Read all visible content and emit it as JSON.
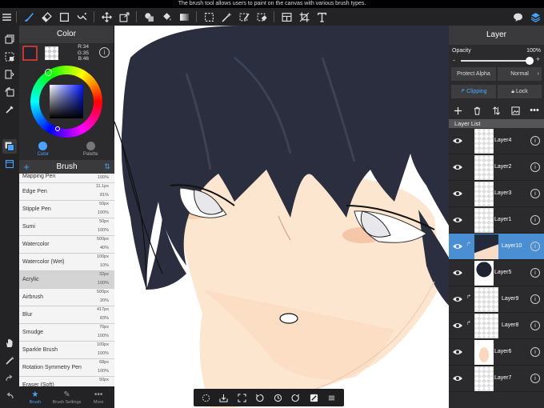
{
  "tip": "The brush tool allows users to paint on the canvas with various brush types.",
  "toolbar": {
    "icons": [
      "brush-icon",
      "eraser-icon",
      "rectangle-icon",
      "magic-brush-icon",
      "move-icon",
      "transform-icon",
      "fill-icon",
      "bucket-icon",
      "gradient-icon",
      "lasso-select-icon",
      "magic-wand-icon",
      "select-pen-icon",
      "select-eraser-icon",
      "layout-icon",
      "crop-icon",
      "text-icon",
      "chat-icon",
      "layers-icon"
    ]
  },
  "color": {
    "title": "Color",
    "r": "R:34",
    "g": "G:35",
    "b": "B:46",
    "main_hex": "#22232e",
    "tabs": [
      {
        "label": "Color"
      },
      {
        "label": "Palette"
      }
    ]
  },
  "brush": {
    "title": "Brush",
    "items": [
      {
        "name": "Mapping Pen",
        "size": "",
        "opacity": "100%"
      },
      {
        "name": "Edge Pen",
        "size": "11.1px",
        "opacity": "81%"
      },
      {
        "name": "Stipple Pen",
        "size": "50px",
        "opacity": "100%"
      },
      {
        "name": "Sumi",
        "size": "50px",
        "opacity": "100%"
      },
      {
        "name": "Watercolor",
        "size": "500px",
        "opacity": "40%"
      },
      {
        "name": "Watercolor (Wet)",
        "size": "100px",
        "opacity": "10%"
      },
      {
        "name": "Acrylic",
        "size": "32px",
        "opacity": "100%"
      },
      {
        "name": "Airbrush",
        "size": "500px",
        "opacity": "20%"
      },
      {
        "name": "Blur",
        "size": "417px",
        "opacity": "83%"
      },
      {
        "name": "Smudge",
        "size": "70px",
        "opacity": "100%"
      },
      {
        "name": "Sparkle Brush",
        "size": "100px",
        "opacity": "100%"
      },
      {
        "name": "Rotation Symmetry Pen",
        "size": "68px",
        "opacity": "100%"
      },
      {
        "name": "Eraser (Soft)",
        "size": "50px",
        "opacity": ""
      }
    ],
    "tabs": [
      {
        "label": "Brush"
      },
      {
        "label": "Brush Settings"
      },
      {
        "label": "More"
      }
    ]
  },
  "layer": {
    "title": "Layer",
    "opacity_label": "Opacity",
    "opacity_value": "100%",
    "opacity_fraction": 1.0,
    "protect_alpha": "Protect Alpha",
    "blend_mode": "Normal",
    "clipping": "Clipping",
    "lock": "Lock",
    "list_header": "Layer List",
    "layers": [
      {
        "name": "Layer4",
        "clipped": false,
        "active": false
      },
      {
        "name": "Layer2",
        "clipped": false,
        "active": false
      },
      {
        "name": "Layer3",
        "clipped": false,
        "active": false
      },
      {
        "name": "Layer1",
        "clipped": false,
        "active": false
      },
      {
        "name": "Layer10",
        "clipped": true,
        "active": true
      },
      {
        "name": "Layer5",
        "clipped": false,
        "active": false
      },
      {
        "name": "Layer9",
        "clipped": true,
        "active": false
      },
      {
        "name": "Layer8",
        "clipped": true,
        "active": false
      },
      {
        "name": "Layer6",
        "clipped": false,
        "active": false
      },
      {
        "name": "Layer7",
        "clipped": false,
        "active": false
      }
    ]
  },
  "accent": "#4aa3ff"
}
